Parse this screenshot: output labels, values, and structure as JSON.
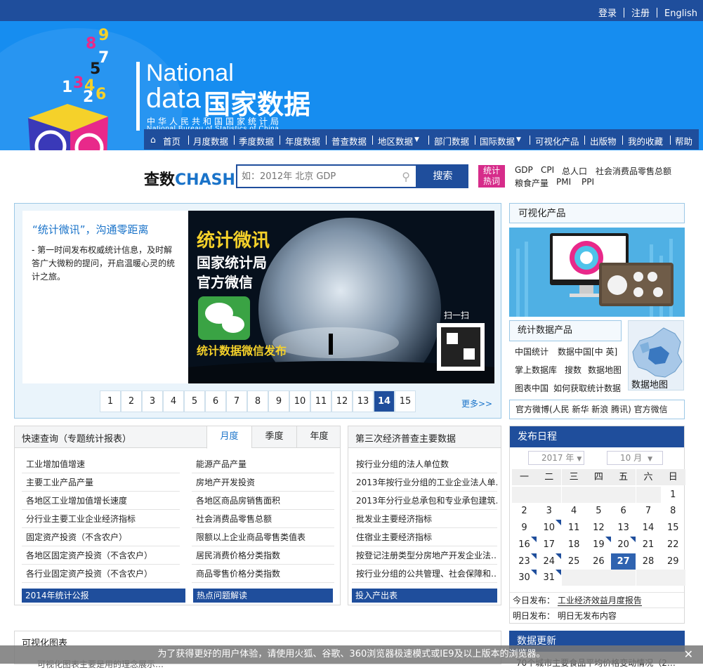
{
  "top": {
    "login": "登录",
    "register": "注册",
    "english": "English"
  },
  "logo": {
    "national": "National",
    "data": "data",
    "cn": "国家数据",
    "sub_cn": "中华人民共和国国家统计局",
    "sub_en": "National Bureau of Statistics of China",
    "digits": [
      "9",
      "8",
      "7",
      "5",
      "1",
      "3",
      "4",
      "2",
      "6"
    ]
  },
  "nav": {
    "items": [
      "首页",
      "月度数据",
      "季度数据",
      "年度数据",
      "普查数据",
      "地区数据",
      "部门数据",
      "国际数据",
      "可视化产品",
      "出版物",
      "我的收藏",
      "帮助"
    ]
  },
  "search": {
    "brand_cn": "查数",
    "brand_en": "CHASHU",
    "placeholder": "如：2012年 北京 GDP",
    "button": "搜索",
    "hot_label_1": "统计",
    "hot_label_2": "热词",
    "hot_words_1": [
      "GDP",
      "CPI",
      "总人口",
      "社会消费品零售总额"
    ],
    "hot_words_2": [
      "粮食产量",
      "PMI",
      "PPI"
    ]
  },
  "slider": {
    "title": "“统计微讯”，沟通零距离",
    "desc": "- 第一时间发布权威统计信息，及时解答广大微粉的提问，开启温暖心灵的统计之旅。",
    "img_title1": "统计微讯",
    "img_title2": "国家统计局",
    "img_title3": "官方微信",
    "img_caption": "统计数据微信发布",
    "img_scan": "扫一扫",
    "pages": [
      "1",
      "2",
      "3",
      "4",
      "5",
      "6",
      "7",
      "8",
      "9",
      "10",
      "11",
      "12",
      "13",
      "14",
      "15"
    ],
    "active_page": "14",
    "more": "更多>>"
  },
  "side": {
    "viz_title": "可视化产品",
    "stat_title": "统计数据产品",
    "stat_items": [
      "中国统计",
      "数据中国[中 英]",
      "掌上数据库",
      "搜数",
      "数据地图",
      "图表中国",
      "如何获取统计数据"
    ],
    "map_label": "数据地图",
    "weibo": "官方微博(人民 新华 新浪 腾讯) 官方微信"
  },
  "quick": {
    "title": "快速查询（专题统计报表）",
    "tabs": [
      "月度",
      "季度",
      "年度"
    ],
    "left": [
      "工业增加值增速",
      "主要工业产品产量",
      "各地区工业增加值增长速度",
      "分行业主要工业企业经济指标",
      "固定资产投资（不含农户）",
      "各地区固定资产投资（不含农户）",
      "各行业固定资产投资（不含农户）"
    ],
    "right": [
      "能源产品产量",
      "房地产开发投资",
      "各地区商品房销售面积",
      "社会消费品零售总额",
      "限额以上企业商品零售类值表",
      "居民消费价格分类指数",
      "商品零售价格分类指数"
    ],
    "bar_left": "2014年统计公报",
    "bar_right": "热点问题解读"
  },
  "census": {
    "title": "第三次经济普查主要数据",
    "items": [
      "按行业分组的法人单位数",
      "2013年按行业分组的工业企业法人单…",
      "2013年分行业总承包和专业承包建筑…",
      "批发业主要经济指标",
      "住宿业主要经济指标",
      "按登记注册类型分房地产开发企业法…",
      "按行业分组的公共管理、社会保障和…"
    ],
    "bar": "投入产出表"
  },
  "calendar": {
    "title": "发布日程",
    "year": "2017 年",
    "month": "10 月",
    "weekdays": [
      "一",
      "二",
      "三",
      "四",
      "五",
      "六",
      "日"
    ],
    "days": [
      "",
      "",
      "",
      "",
      "",
      "",
      "1",
      "2",
      "3",
      "4",
      "5",
      "6",
      "7",
      "8",
      "9",
      "10",
      "11",
      "12",
      "13",
      "14",
      "15",
      "16",
      "17",
      "18",
      "19",
      "20",
      "21",
      "22",
      "23",
      "24",
      "25",
      "26",
      "27",
      "28",
      "29",
      "30",
      "31",
      "",
      "",
      "",
      "",
      ""
    ],
    "today": "27",
    "release_today_label": "今日发布：",
    "release_today": "工业经济效益月度报告",
    "release_tomorrow_label": "明日发布：",
    "release_tomorrow": "明日无发布内容"
  },
  "bottom": {
    "viz_chart": "可视化图表",
    "viz_sub": "可视化图表主要是用的理念展示…",
    "data_update": "数据更新",
    "data_sub": "70个城市主要食品平均价格变动情况（2…"
  },
  "notice": {
    "text": "为了获得更好的用户体验，请使用火狐、谷歌、360浏览器极速模式或IE9及以上版本的浏览器。",
    "close": "✕"
  }
}
